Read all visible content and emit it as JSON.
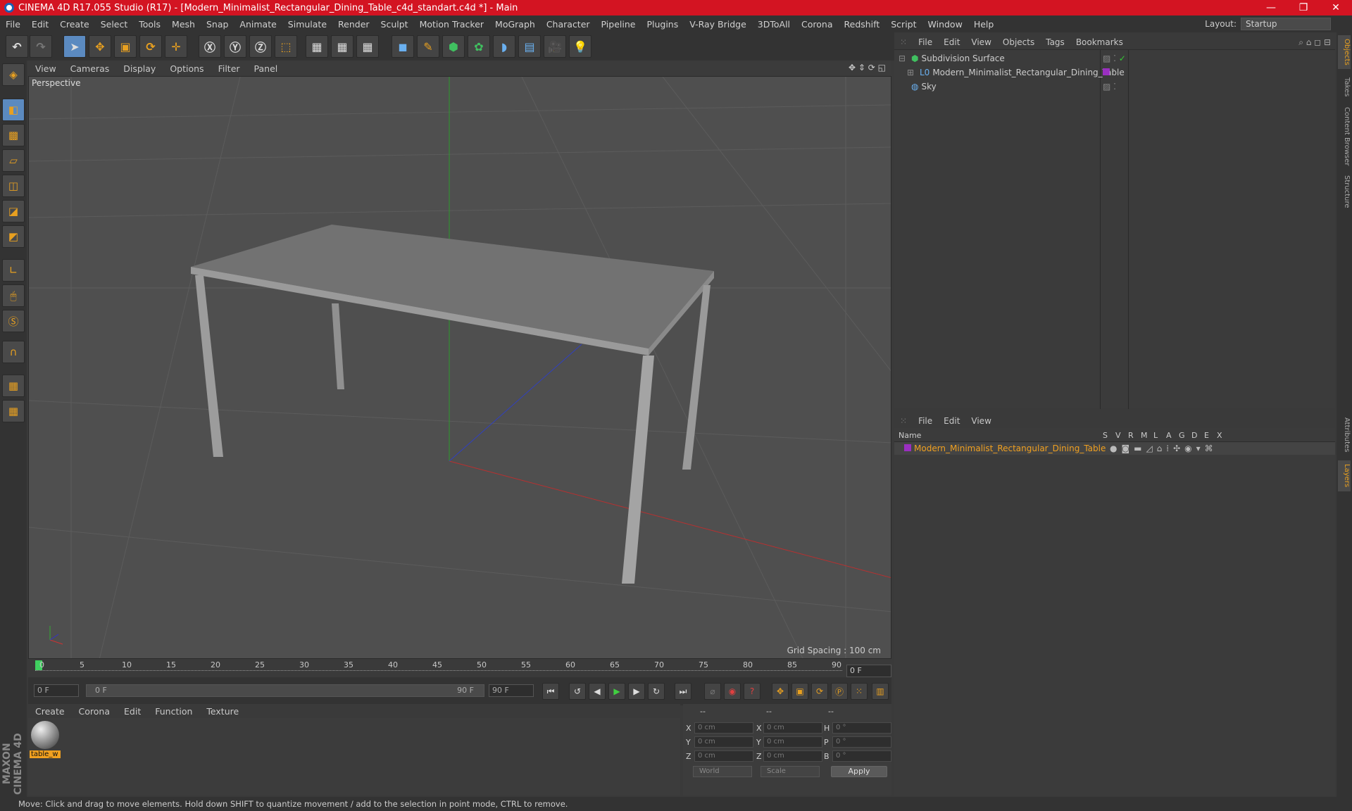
{
  "window": {
    "title": "CINEMA 4D R17.055 Studio (R17) - [Modern_Minimalist_Rectangular_Dining_Table_c4d_standart.c4d *] - Main"
  },
  "menu": [
    "File",
    "Edit",
    "Create",
    "Select",
    "Tools",
    "Mesh",
    "Snap",
    "Animate",
    "Simulate",
    "Render",
    "Sculpt",
    "Motion Tracker",
    "MoGraph",
    "Character",
    "Pipeline",
    "Plugins",
    "V-Ray Bridge",
    "3DToAll",
    "Corona",
    "Redshift",
    "Script",
    "Window",
    "Help"
  ],
  "layout": {
    "label": "Layout:",
    "value": "Startup"
  },
  "viewport": {
    "menu": [
      "View",
      "Cameras",
      "Display",
      "Options",
      "Filter",
      "Panel"
    ],
    "label": "Perspective",
    "grid_spacing": "Grid Spacing : 100 cm"
  },
  "timeline": {
    "ticks": [
      "0",
      "5",
      "10",
      "15",
      "20",
      "25",
      "30",
      "35",
      "40",
      "45",
      "50",
      "55",
      "60",
      "65",
      "70",
      "75",
      "80",
      "85",
      "90"
    ],
    "current_frame": "0 F",
    "start_field": "0 F",
    "range_start": "0 F",
    "range_end": "90 F",
    "end_field": "90 F"
  },
  "materials": {
    "menu": [
      "Create",
      "Corona",
      "Edit",
      "Function",
      "Texture"
    ],
    "items": [
      {
        "name": "table_w"
      }
    ]
  },
  "coords": {
    "headers": [
      "--",
      "--",
      "--"
    ],
    "rows": [
      {
        "l1": "X",
        "v1": "0 cm",
        "l2": "X",
        "v2": "0 cm",
        "l3": "H",
        "v3": "0 °"
      },
      {
        "l1": "Y",
        "v1": "0 cm",
        "l2": "Y",
        "v2": "0 cm",
        "l3": "P",
        "v3": "0 °"
      },
      {
        "l1": "Z",
        "v1": "0 cm",
        "l2": "Z",
        "v2": "0 cm",
        "l3": "B",
        "v3": "0 °"
      }
    ],
    "mode": "World",
    "scale": "Scale",
    "apply": "Apply"
  },
  "objects": {
    "menu": [
      "File",
      "Edit",
      "View",
      "Objects",
      "Tags",
      "Bookmarks"
    ],
    "items": [
      {
        "name": "Subdivision Surface"
      },
      {
        "name": "Modern_Minimalist_Rectangular_Dining_Table"
      },
      {
        "name": "Sky"
      }
    ]
  },
  "layers": {
    "menu": [
      "File",
      "Edit",
      "View"
    ],
    "columns": [
      "Name",
      "S",
      "V",
      "R",
      "M",
      "L",
      "A",
      "G",
      "D",
      "E",
      "X"
    ],
    "items": [
      {
        "name": "Modern_Minimalist_Rectangular_Dining_Table",
        "color": "#9a2fc0"
      }
    ]
  },
  "right_tabs": [
    "Objects",
    "Takes",
    "Content Browser",
    "Structure",
    "Attributes",
    "Layers"
  ],
  "status": "Move: Click and drag to move elements. Hold down SHIFT to quantize movement / add to the selection in point mode, CTRL to remove.",
  "colors": {
    "title_bar": "#d31422",
    "accent": "#e8a020",
    "x_axis": "#c03030",
    "y_axis": "#30a030",
    "z_axis": "#3040c0"
  }
}
